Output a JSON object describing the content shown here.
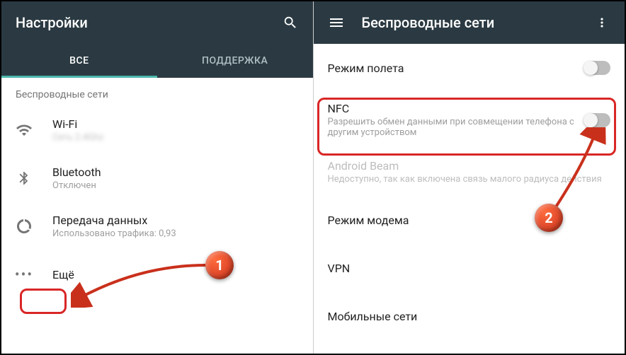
{
  "left": {
    "title": "Настройки",
    "tabs": {
      "all": "ВСЕ",
      "support": "ПОДДЕРЖКА"
    },
    "section": "Беспроводные сети",
    "wifi": {
      "label": "Wi-Fi",
      "sub": "Сеть 2.4Ghz"
    },
    "bluetooth": {
      "label": "Bluetooth",
      "sub": "Отключен"
    },
    "data": {
      "label": "Передача данных",
      "sub": "Использовано трафика: 0,93"
    },
    "more": {
      "label": "Ещё"
    }
  },
  "right": {
    "title": "Беспроводные сети",
    "airplane": {
      "label": "Режим полета"
    },
    "nfc": {
      "label": "NFC",
      "sub": "Разрешить обмен данными при совмещении телефона с другим устройством"
    },
    "beam": {
      "label": "Android Beam",
      "sub": "Недоступно, так как включена связь малого радиуса действия"
    },
    "tether": {
      "label": "Режим модема"
    },
    "vpn": {
      "label": "VPN"
    },
    "mobile": {
      "label": "Мобильные сети"
    }
  },
  "badges": {
    "b1": "1",
    "b2": "2"
  }
}
